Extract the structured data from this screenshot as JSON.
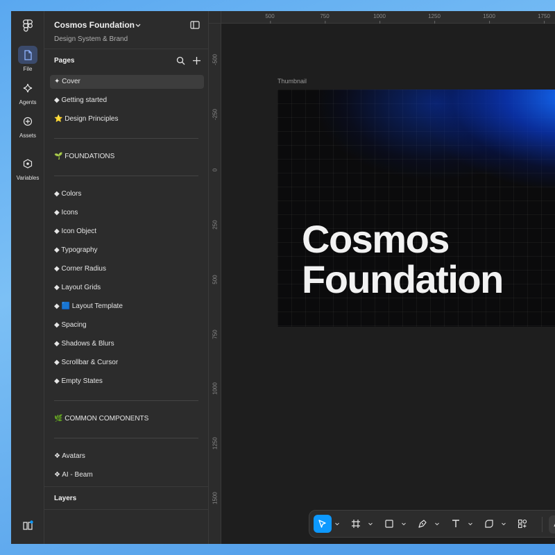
{
  "rail": {
    "logo_icon": "figma-logo-icon",
    "items": [
      {
        "label": "File",
        "icon": "file-icon",
        "active": true
      },
      {
        "label": "Agents",
        "icon": "sparkle-icon",
        "active": false
      },
      {
        "label": "Assets",
        "icon": "plus-circle-icon",
        "active": false
      },
      {
        "label": "Variables",
        "icon": "variables-icon",
        "active": false
      }
    ],
    "bottom_icon": "book-icon"
  },
  "panel": {
    "file_title": "Cosmos Foundation",
    "file_subtitle": "Design System & Brand",
    "pages_header": "Pages",
    "layers_header": "Layers",
    "pages": [
      {
        "label": "✦ Cover",
        "selected": true
      },
      {
        "label": "◆ Getting started"
      },
      {
        "label": "⭐ Design Principles"
      },
      {
        "label": "🌱 FOUNDATIONS"
      },
      {
        "label": "◆ Colors"
      },
      {
        "label": "◆ Icons"
      },
      {
        "label": "◆ Icon Object"
      },
      {
        "label": "◆ Typography"
      },
      {
        "label": "◆ Corner Radius"
      },
      {
        "label": "◆ Layout Grids"
      },
      {
        "label": "◆ 🟦 Layout Template"
      },
      {
        "label": "◆ Spacing"
      },
      {
        "label": "◆ Shadows & Blurs"
      },
      {
        "label": "◆ Scrollbar & Cursor"
      },
      {
        "label": "◆ Empty States"
      },
      {
        "label": "🌿 COMMON COMPONENTS"
      },
      {
        "label": "❖ Avatars"
      },
      {
        "label": "❖ AI - Beam"
      }
    ]
  },
  "canvas": {
    "ruler_x": [
      "500",
      "750",
      "1000",
      "1250",
      "1500",
      "1750"
    ],
    "ruler_y": [
      "-500",
      "-250",
      "0",
      "250",
      "500",
      "750",
      "1000",
      "1250",
      "1500"
    ],
    "frame_label": "Thumbnail",
    "cover_title_line1": "Cosmos",
    "cover_title_line2": "Foundation"
  },
  "toolbar": {
    "tools": [
      "move-tool",
      "frame-tool",
      "rectangle-tool",
      "pen-tool",
      "text-tool",
      "shape-tool",
      "components-tool"
    ],
    "active_tool": "move-tool"
  },
  "colors": {
    "accent": "#0d99ff",
    "canvas_bg": "#1e1e1e",
    "panel_bg": "#2c2c2c"
  }
}
